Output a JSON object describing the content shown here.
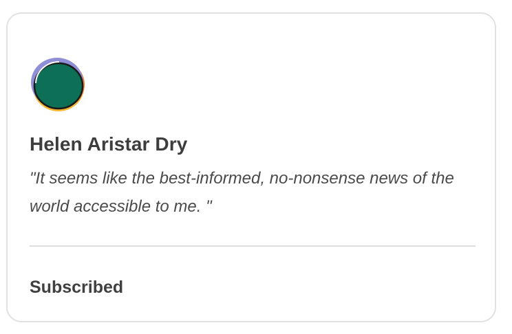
{
  "testimonial": {
    "name": "Helen Aristar Dry",
    "quote": "\"It seems like the best-informed, no-nonsense news of the world accessible to me. \"",
    "status": "Subscribed",
    "avatar": {
      "icon": "globe-logo-icon",
      "colors": {
        "primary": "#0d6f55",
        "accent_orange": "#f07a2a",
        "accent_yellow": "#f7b733",
        "accent_purple": "#8e8fd6",
        "outline": "#1a1a1a"
      }
    }
  }
}
